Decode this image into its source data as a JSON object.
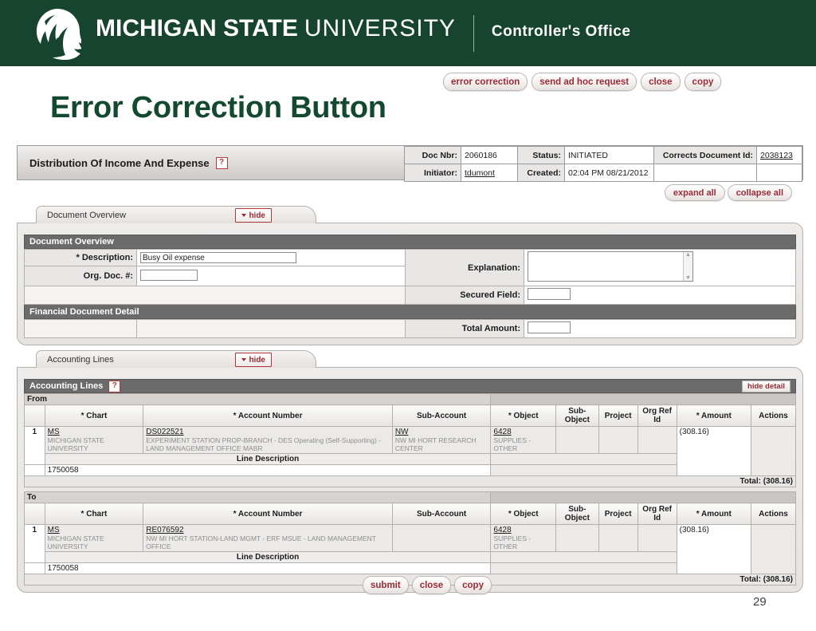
{
  "banner": {
    "logo_icon": "spartan-helmet-icon",
    "wordmark_bold": "MICHIGAN STATE",
    "wordmark_light": "UNIVERSITY",
    "sub_unit": "Controller's Office",
    "background_color": "#16442f"
  },
  "slide": {
    "title": "Error Correction Button",
    "title_color": "#12492f",
    "page_number": "29"
  },
  "top_actions": [
    {
      "label": "error correction",
      "name": "error-correction-button"
    },
    {
      "label": "send ad hoc request",
      "name": "send-ad-hoc-request-button"
    },
    {
      "label": "close",
      "name": "close-button"
    },
    {
      "label": "copy",
      "name": "copy-button"
    }
  ],
  "doc_header": {
    "title": "Distribution Of Income And Expense",
    "help_icon": "question-mark-icon",
    "fields": {
      "doc_nbr_label": "Doc Nbr:",
      "doc_nbr_value": "2060186",
      "status_label": "Status:",
      "status_value": "INITIATED",
      "corrects_label": "Corrects Document Id:",
      "corrects_value": "2038123",
      "initiator_label": "Initiator:",
      "initiator_value": "tdumont",
      "created_label": "Created:",
      "created_value": "02:04 PM 08/21/2012"
    },
    "expand_all": "expand all",
    "collapse_all": "collapse all"
  },
  "document_overview": {
    "tab_label": "Document Overview",
    "hide_label": "hide",
    "section_label": "Document Overview",
    "description_label": "* Description:",
    "description_value": "Busy Oil expense",
    "org_doc_label": "Org. Doc. #:",
    "org_doc_value": "",
    "explanation_label": "Explanation:",
    "explanation_value": "",
    "secured_field_label": "Secured Field:",
    "secured_field_value": "",
    "financial_detail_label": "Financial Document Detail",
    "total_amount_label": "Total Amount:",
    "total_amount_value": ""
  },
  "accounting_lines": {
    "tab_label": "Accounting Lines",
    "hide_label": "hide",
    "section_label": "Accounting Lines",
    "help_icon": "question-mark-icon",
    "hide_detail_label": "hide detail",
    "columns": [
      "* Chart",
      "* Account Number",
      "Sub-Account",
      "* Object",
      "Sub-Object",
      "Project",
      "Org Ref Id",
      "* Amount",
      "Actions"
    ],
    "line_description_header": "Line Description",
    "groups": [
      {
        "label": "From",
        "rows": [
          {
            "num": "1",
            "chart_code": "MS",
            "chart_desc": "MICHIGAN STATE UNIVERSITY",
            "account_code": "DS022521",
            "account_desc": "EXPERIMENT STATION PROP-BRANCH - DES Operating (Self-Supporting) - LAND MANAGEMENT OFFICE MABR",
            "sub_account_code": "NW",
            "sub_account_desc": "NW MI HORT RESEARCH CENTER",
            "object_code": "6428",
            "object_desc": "SUPPLIES - OTHER",
            "sub_object": "",
            "project": "",
            "org_ref_id": "",
            "amount": "(308.16)",
            "actions": "",
            "line_description": "1750058"
          }
        ],
        "total_label": "Total: (308.16)"
      },
      {
        "label": "To",
        "rows": [
          {
            "num": "1",
            "chart_code": "MS",
            "chart_desc": "MICHIGAN STATE UNIVERSITY",
            "account_code": "RE076592",
            "account_desc": "NW MI HORT STATION-LAND MGMT - ERF MSUE - LAND MANAGEMENT OFFICE",
            "sub_account_code": "",
            "sub_account_desc": "",
            "object_code": "6428",
            "object_desc": "SUPPLIES - OTHER",
            "sub_object": "",
            "project": "",
            "org_ref_id": "",
            "amount": "(308.16)",
            "actions": "",
            "line_description": "1750058"
          }
        ],
        "total_label": "Total: (308.16)"
      }
    ]
  },
  "bottom_actions": [
    {
      "label": "submit",
      "name": "submit-button"
    },
    {
      "label": "close",
      "name": "close-button-bottom"
    },
    {
      "label": "copy",
      "name": "copy-button-bottom"
    }
  ]
}
